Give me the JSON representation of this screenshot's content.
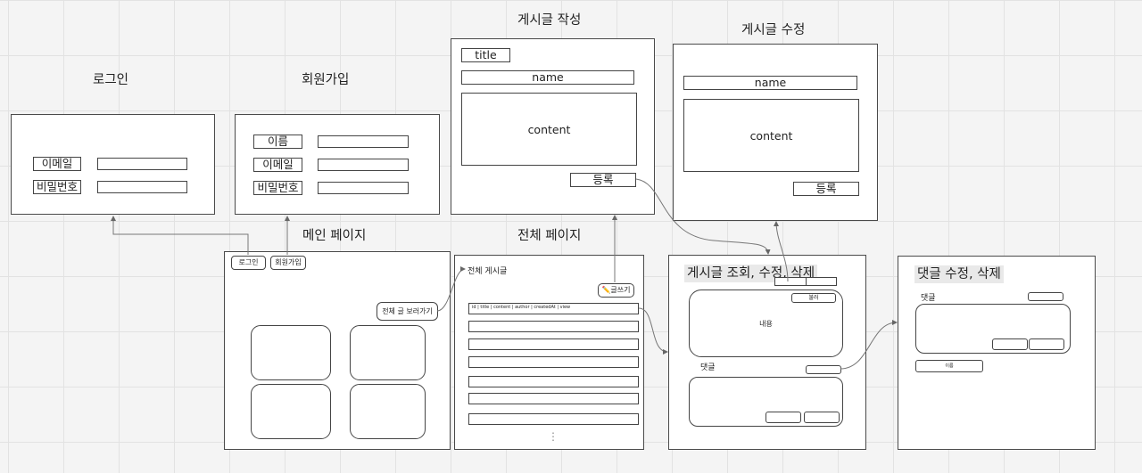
{
  "login": {
    "title": "로그인",
    "email_label": "이메일",
    "password_label": "비밀번호"
  },
  "signup": {
    "title": "회원가입",
    "name_label": "이름",
    "email_label": "이메일",
    "password_label": "비밀번호"
  },
  "write": {
    "title": "게시글 작성",
    "title_field": "title",
    "name_field": "name",
    "content_field": "content",
    "submit": "등록"
  },
  "edit": {
    "title": "게시글 수정",
    "name_field": "name",
    "content_field": "content",
    "submit": "등록"
  },
  "main": {
    "title": "메인 페이지",
    "login_button": "로그인",
    "signup_button": "회원가입",
    "view_all_button": "전체 글 보러가기"
  },
  "list": {
    "title": "전체 페이지",
    "heading": "전체 게시글",
    "write_button": "✏️글쓰기",
    "header_row": "id | title | content | author | createdAt | view",
    "ellipsis": "⋮"
  },
  "detail": {
    "title": "게시글 조회, 수정, 삭제",
    "button_small": "불러",
    "content": "내용",
    "comments_label": "댓글"
  },
  "comment": {
    "title": "댓글 수정, 삭제",
    "comments_label": "댓글",
    "button": "이름"
  },
  "colors": {
    "frame_border": "#4a4a4a",
    "grid": "#e2e2e2",
    "background": "#f4f4f4"
  }
}
